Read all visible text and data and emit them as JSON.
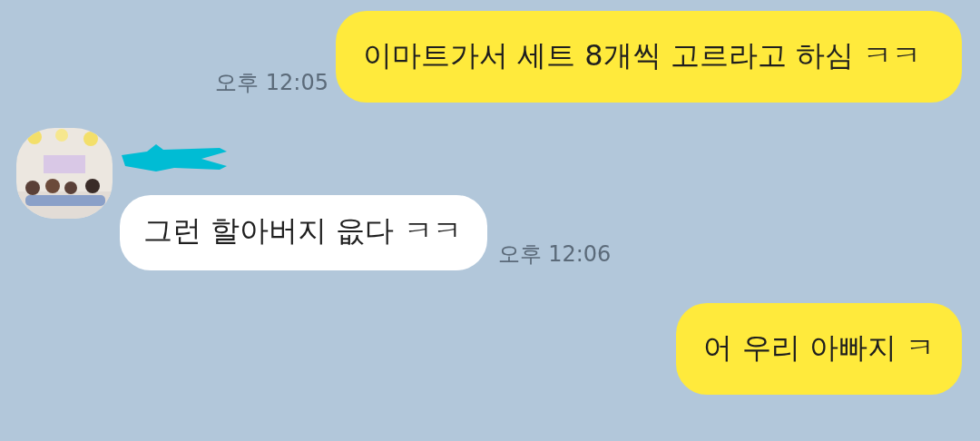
{
  "messages": [
    {
      "kind": "sent",
      "text": "이마트가서 세트 8개씩 고르라고 하심 ㅋㅋ",
      "time": "오후 12:05"
    },
    {
      "kind": "received",
      "name_redacted": true,
      "text": "그런 할아버지 읎다 ㅋㅋ",
      "time": "오후 12:06"
    },
    {
      "kind": "sent",
      "text": "어 우리 아빠지 ㅋ"
    }
  ]
}
